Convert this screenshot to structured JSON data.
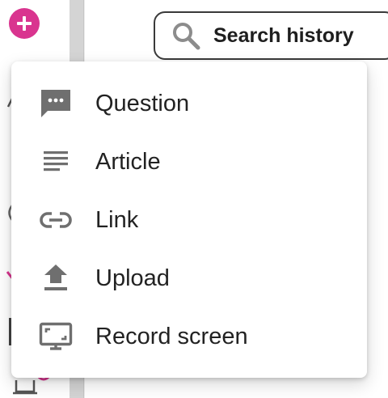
{
  "colors": {
    "accent": "#d9348f",
    "icon_gray": "#6f6f6f",
    "text": "#222222"
  },
  "rail": {
    "add_button_icon": "plus-icon"
  },
  "search_history": {
    "icon": "search-icon",
    "label": "Search history"
  },
  "menu": {
    "items": [
      {
        "label": "Question",
        "icon": "chat-bubble-icon"
      },
      {
        "label": "Article",
        "icon": "text-lines-icon"
      },
      {
        "label": "Link",
        "icon": "link-icon"
      },
      {
        "label": "Upload",
        "icon": "upload-icon"
      },
      {
        "label": "Record screen",
        "icon": "record-screen-icon"
      }
    ]
  }
}
